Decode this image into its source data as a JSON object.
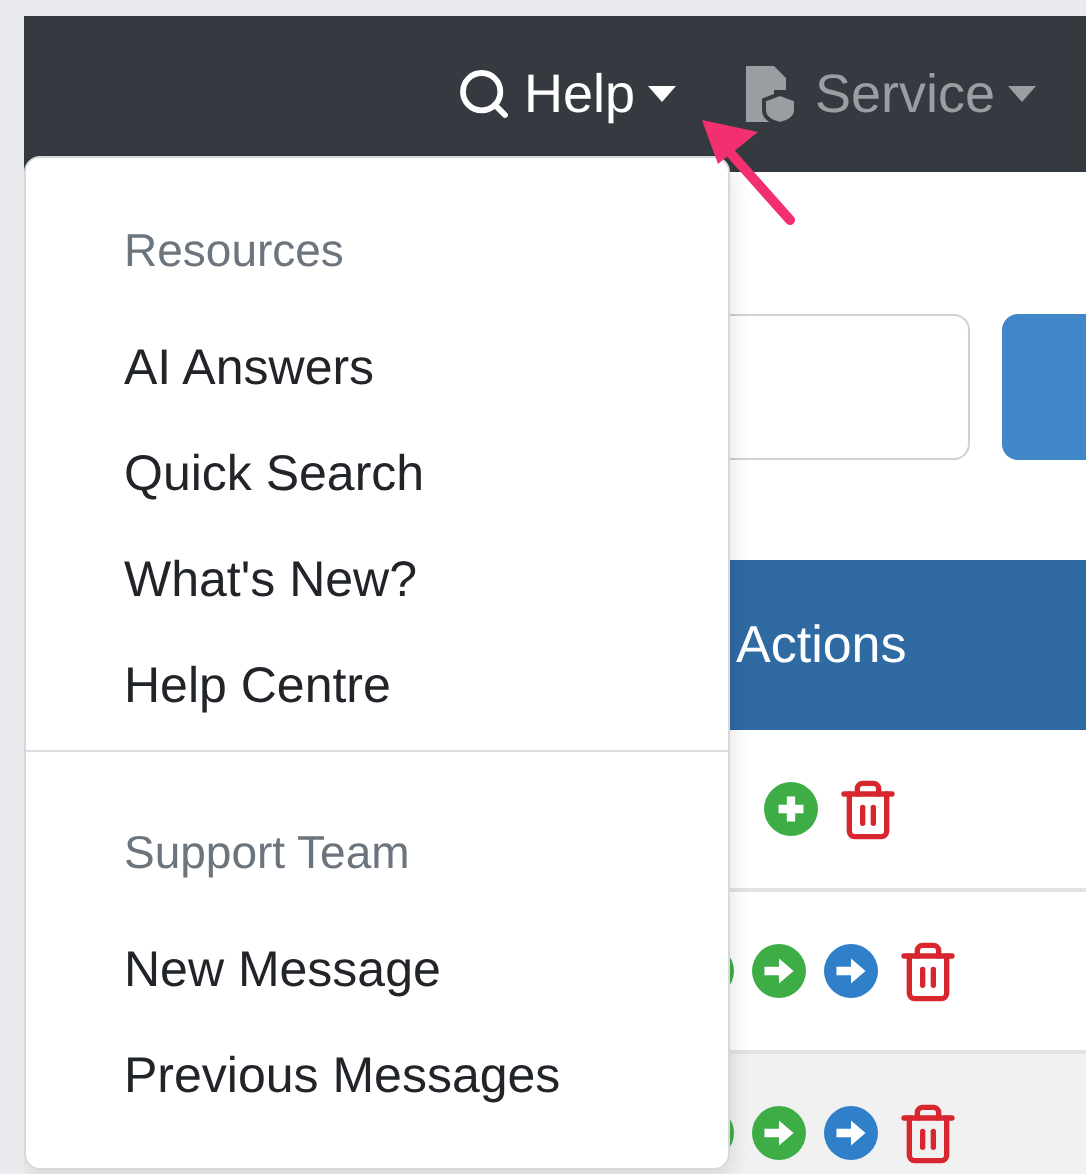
{
  "navbar": {
    "items": [
      {
        "label": "Help",
        "kind": "search",
        "expanded": true
      },
      {
        "label": "Service",
        "kind": "service",
        "expanded": false
      }
    ]
  },
  "help_menu": {
    "sections": [
      {
        "heading": "Resources",
        "items": [
          "AI Answers",
          "Quick Search",
          "What's New?",
          "Help Centre"
        ]
      },
      {
        "heading": "Support Team",
        "items": [
          "New Message",
          "Previous Messages"
        ]
      }
    ]
  },
  "table": {
    "columns": [
      "Actions"
    ],
    "rows": [
      {
        "highlighted": false,
        "actions": [
          {
            "kind": "add"
          },
          {
            "kind": "delete"
          }
        ]
      },
      {
        "highlighted": false,
        "actions": [
          {
            "kind": "advance"
          },
          {
            "kind": "advance"
          },
          {
            "kind": "send"
          },
          {
            "kind": "delete"
          }
        ]
      },
      {
        "highlighted": true,
        "actions": [
          {
            "kind": "advance"
          },
          {
            "kind": "advance"
          },
          {
            "kind": "send"
          },
          {
            "kind": "delete"
          }
        ]
      }
    ]
  }
}
